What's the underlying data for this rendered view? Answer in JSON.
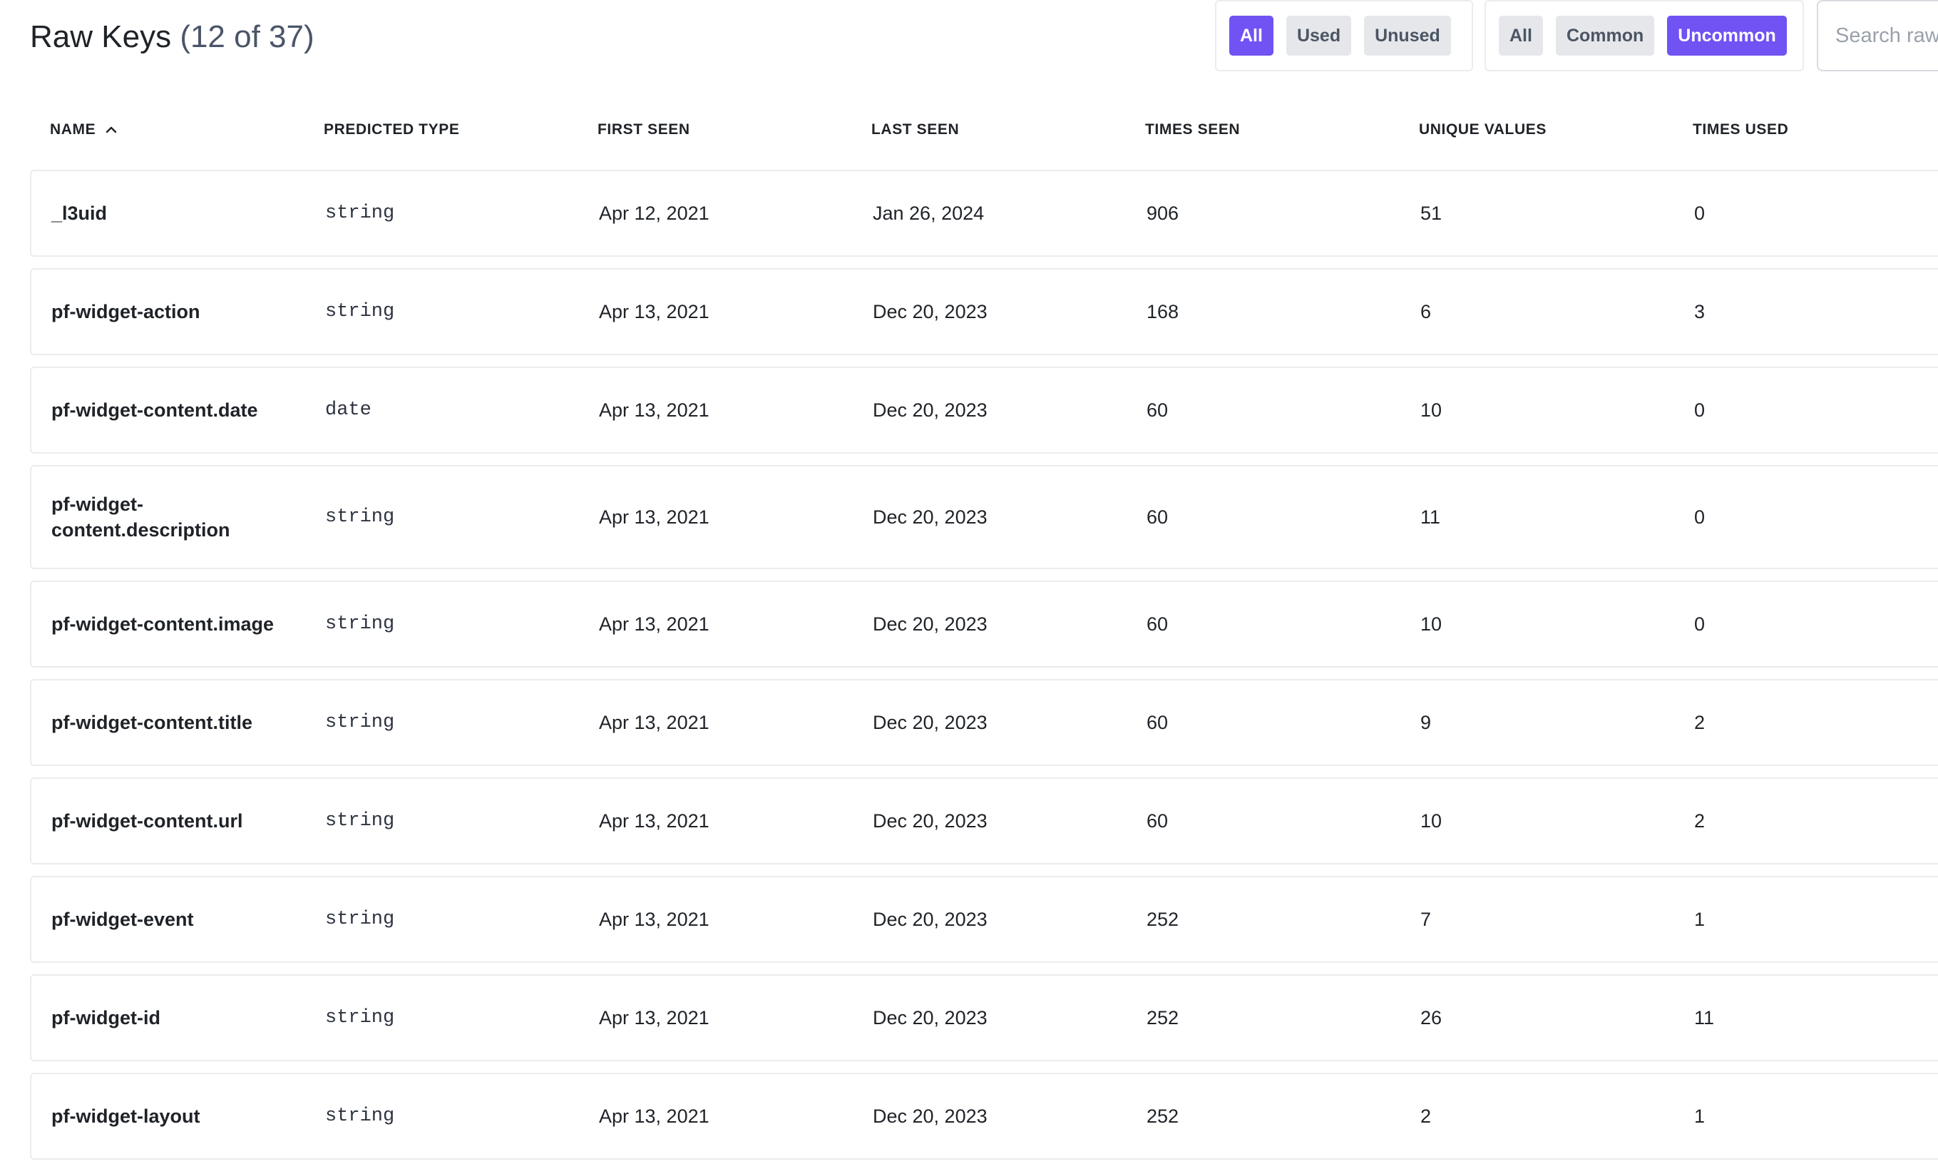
{
  "header": {
    "title": "Raw Keys",
    "count": "(12 of 37)"
  },
  "filters": {
    "usage": [
      "All",
      "Used",
      "Unused"
    ],
    "usage_active": "All",
    "frequency": [
      "All",
      "Common",
      "Uncommon"
    ],
    "frequency_active": "Uncommon"
  },
  "search": {
    "placeholder": "Search raw"
  },
  "columns": [
    "NAME",
    "PREDICTED TYPE",
    "FIRST SEEN",
    "LAST SEEN",
    "TIMES SEEN",
    "UNIQUE VALUES",
    "TIMES USED"
  ],
  "sort": {
    "column": "NAME",
    "direction": "ascending",
    "icon": "chevron-up-icon"
  },
  "rows": [
    {
      "name": "_l3uid",
      "type": "string",
      "first_seen": "Apr 12, 2021",
      "last_seen": "Jan 26, 2024",
      "times_seen": "906",
      "unique_values": "51",
      "times_used": "0"
    },
    {
      "name": "pf-widget-action",
      "type": "string",
      "first_seen": "Apr 13, 2021",
      "last_seen": "Dec 20, 2023",
      "times_seen": "168",
      "unique_values": "6",
      "times_used": "3"
    },
    {
      "name": "pf-widget-content.date",
      "type": "date",
      "first_seen": "Apr 13, 2021",
      "last_seen": "Dec 20, 2023",
      "times_seen": "60",
      "unique_values": "10",
      "times_used": "0"
    },
    {
      "name": "pf-widget-content.description",
      "type": "string",
      "first_seen": "Apr 13, 2021",
      "last_seen": "Dec 20, 2023",
      "times_seen": "60",
      "unique_values": "11",
      "times_used": "0"
    },
    {
      "name": "pf-widget-content.image",
      "type": "string",
      "first_seen": "Apr 13, 2021",
      "last_seen": "Dec 20, 2023",
      "times_seen": "60",
      "unique_values": "10",
      "times_used": "0"
    },
    {
      "name": "pf-widget-content.title",
      "type": "string",
      "first_seen": "Apr 13, 2021",
      "last_seen": "Dec 20, 2023",
      "times_seen": "60",
      "unique_values": "9",
      "times_used": "2"
    },
    {
      "name": "pf-widget-content.url",
      "type": "string",
      "first_seen": "Apr 13, 2021",
      "last_seen": "Dec 20, 2023",
      "times_seen": "60",
      "unique_values": "10",
      "times_used": "2"
    },
    {
      "name": "pf-widget-event",
      "type": "string",
      "first_seen": "Apr 13, 2021",
      "last_seen": "Dec 20, 2023",
      "times_seen": "252",
      "unique_values": "7",
      "times_used": "1"
    },
    {
      "name": "pf-widget-id",
      "type": "string",
      "first_seen": "Apr 13, 2021",
      "last_seen": "Dec 20, 2023",
      "times_seen": "252",
      "unique_values": "26",
      "times_used": "11"
    },
    {
      "name": "pf-widget-layout",
      "type": "string",
      "first_seen": "Apr 13, 2021",
      "last_seen": "Dec 20, 2023",
      "times_seen": "252",
      "unique_values": "2",
      "times_used": "1"
    }
  ],
  "colors": {
    "accent": "#7152f3",
    "pill_inactive": "#e5e7eb",
    "border": "#ececef"
  }
}
